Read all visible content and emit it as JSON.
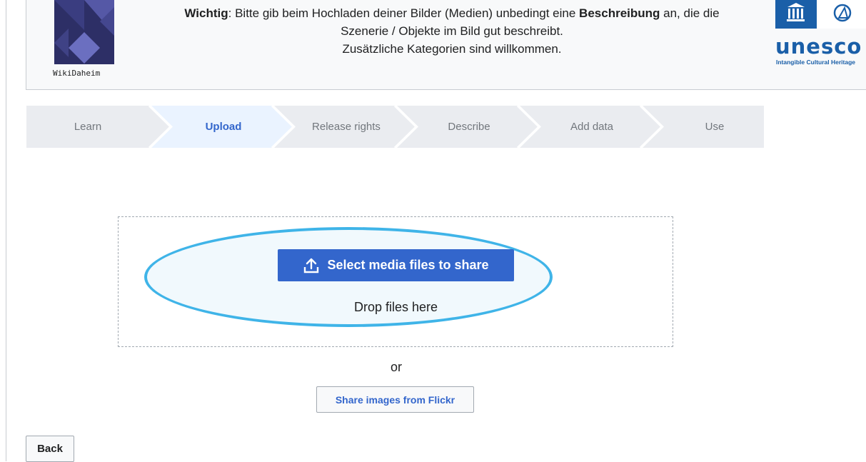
{
  "banner": {
    "logo_caption": "WikiDaheim",
    "notice_strong_1": "Wichtig",
    "notice_part_1": ": Bitte gib beim Hochladen deiner Bilder (Medien) unbedingt eine ",
    "notice_strong_2": "Beschreibung",
    "notice_part_2": " an, die die",
    "notice_line_2": "Szenerie / Objekte im Bild gut beschreibt.",
    "notice_line_3": "Zusätzliche Kategorien sind willkommen.",
    "partner_word": "unesco",
    "partner_sub": "Intangible Cultural Heritage"
  },
  "steps": [
    {
      "label": "Learn",
      "active": false
    },
    {
      "label": "Upload",
      "active": true
    },
    {
      "label": "Release rights",
      "active": false
    },
    {
      "label": "Describe",
      "active": false
    },
    {
      "label": "Add data",
      "active": false
    },
    {
      "label": "Use",
      "active": false
    }
  ],
  "upload": {
    "select_label": "Select media files to share",
    "select_icon": "upload-icon",
    "drop_label": "Drop files here",
    "or_label": "or",
    "flickr_label": "Share images from Flickr"
  },
  "nav": {
    "back_label": "Back"
  },
  "colors": {
    "accent": "#3366cc",
    "highlight": "#3fb4e8",
    "step_bg": "#eaecf0",
    "step_active_bg": "#eaf3ff",
    "partner": "#1a5fa8"
  }
}
